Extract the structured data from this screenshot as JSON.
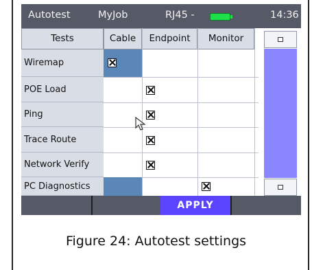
{
  "status_bar": {
    "mode": "Autotest",
    "job": "MyJob",
    "port": "RJ45 -",
    "time": "14:36",
    "battery_color": "#1ee04a"
  },
  "table": {
    "headers": [
      "Tests",
      "Cable",
      "Endpoint",
      "Monitor"
    ],
    "rows": [
      {
        "label": "Wiremap",
        "cable": true,
        "endpoint": false,
        "monitor": false,
        "highlight": "cable"
      },
      {
        "label": "POE Load",
        "cable": false,
        "endpoint": true,
        "monitor": false
      },
      {
        "label": "Ping",
        "cable": false,
        "endpoint": true,
        "monitor": false
      },
      {
        "label": "Trace Route",
        "cable": false,
        "endpoint": true,
        "monitor": false
      },
      {
        "label": "Network Verify",
        "cable": false,
        "endpoint": true,
        "monitor": false
      },
      {
        "label": "PC Diagnostics",
        "cable": false,
        "endpoint": false,
        "monitor": true,
        "highlight": "cable"
      }
    ]
  },
  "scrollbar": {
    "up_icon": "square-icon",
    "down_icon": "square-icon",
    "thumb_color": "#8a86ff"
  },
  "button_bar": {
    "apply_label": "APPLY",
    "apply_color": "#5a44ff"
  },
  "caption": "Figure 24: Autotest settings"
}
